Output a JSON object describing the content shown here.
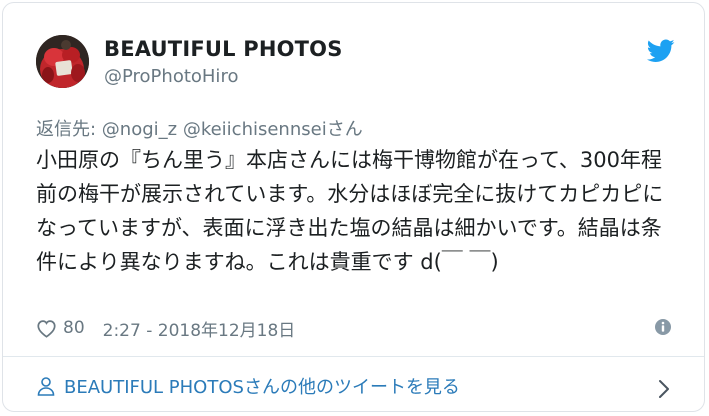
{
  "tweet": {
    "user_name": "BEAUTIFUL PHOTOS",
    "user_handle": "@ProPhotoHiro",
    "reply_prefix": "返信先: ",
    "reply_mentions": "@nogi_z @keiichisennsei",
    "reply_suffix": "さん",
    "text": "小田原の『ちん里う』本店さんには梅干博物館が在って、300年程前の梅干が展示されています。水分はほぼ完全に抜けてカピカピになっていますが、表面に浮き出た塩の結晶は細かいです。結晶は条件により異なりますね。これは貴重です d(￣ ￣)",
    "like_count": "80",
    "timestamp": "2:27 - 2018年12月18日",
    "footer_link": "BEAUTIFUL PHOTOSさんの他のツイートを見る"
  },
  "icons": {
    "logo": "twitter-bird-icon",
    "like": "heart-icon",
    "info": "info-icon",
    "footer": "person-icon",
    "chevron": "chevron-right-icon"
  },
  "colors": {
    "twitter_blue": "#1da1f2",
    "link_blue": "#2b7bb9",
    "text_primary": "#1c2022",
    "text_secondary": "#697882",
    "border": "#dfe3e8"
  }
}
